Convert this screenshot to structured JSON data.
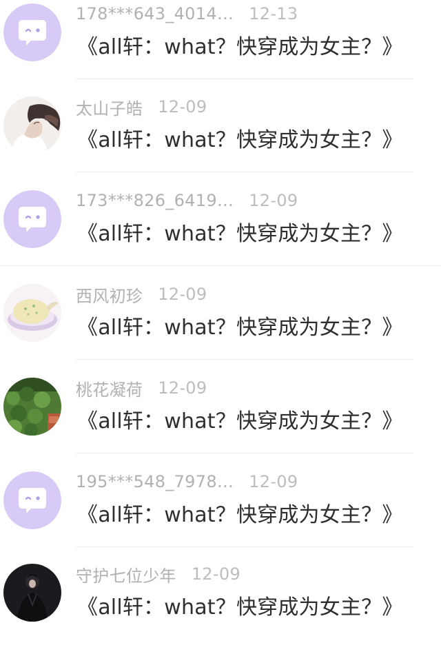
{
  "comments": [
    {
      "username": "178***643_4014…",
      "date": "12-13",
      "book_title": "《all轩：what？快穿成为女主？》",
      "avatar": "default-chat-avatar"
    },
    {
      "username": "太山子皓",
      "date": "12-09",
      "book_title": "《all轩：what？快穿成为女主？》",
      "avatar": "portrait-avatar"
    },
    {
      "username": "173***826_6419…",
      "date": "12-09",
      "book_title": "《all轩：what？快穿成为女主？》",
      "avatar": "default-chat-avatar"
    },
    {
      "username": "西风初珍",
      "date": "12-09",
      "book_title": "《all轩：what？快穿成为女主？》",
      "avatar": "food-bowl-avatar"
    },
    {
      "username": "桃花凝荷",
      "date": "12-09",
      "book_title": "《all轩：what？快穿成为女主？》",
      "avatar": "ivy-wall-avatar"
    },
    {
      "username": "195***548_7978…",
      "date": "12-09",
      "book_title": "《all轩：what？快穿成为女主？》",
      "avatar": "default-chat-avatar"
    },
    {
      "username": "守护七位少年",
      "date": "12-09",
      "book_title": "《all轩：what？快穿成为女主？》",
      "avatar": "dark-figure-avatar"
    }
  ],
  "colors": {
    "default_avatar_bg": "#d8caf7",
    "username": "#b1b1b1",
    "title_text": "#2e2e2e",
    "divider": "#ececec"
  }
}
